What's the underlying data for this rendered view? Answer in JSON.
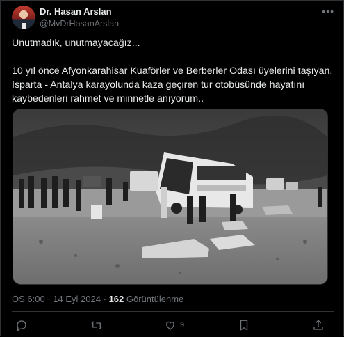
{
  "author": {
    "name": "Dr. Hasan Arslan",
    "handle": "@MvDrHasanArslan"
  },
  "post": {
    "line1": "Unutmadık, unutmayacağız...",
    "line2": "10 yıl önce Afyonkarahisar Kuaförler ve Berberler Odası üyelerini taşıyan, Isparta - Antalya karayolunda kaza geçiren  tur otobüsünde hayatını kaybedenleri rahmet ve minnetle anıyorum.."
  },
  "meta": {
    "time": "ÖS 6:00",
    "separator": "·",
    "date": "14 Eyl 2024",
    "views_count": "162",
    "views_label": "Görüntülenme"
  },
  "actions": {
    "like_count": "9"
  },
  "colors": {
    "background": "#000000",
    "text": "#e7e9ea",
    "muted": "#71767b",
    "border": "#2f3336"
  },
  "icons": [
    "more-options-icon",
    "reply-icon",
    "retweet-icon",
    "like-icon",
    "bookmark-icon",
    "share-icon"
  ]
}
